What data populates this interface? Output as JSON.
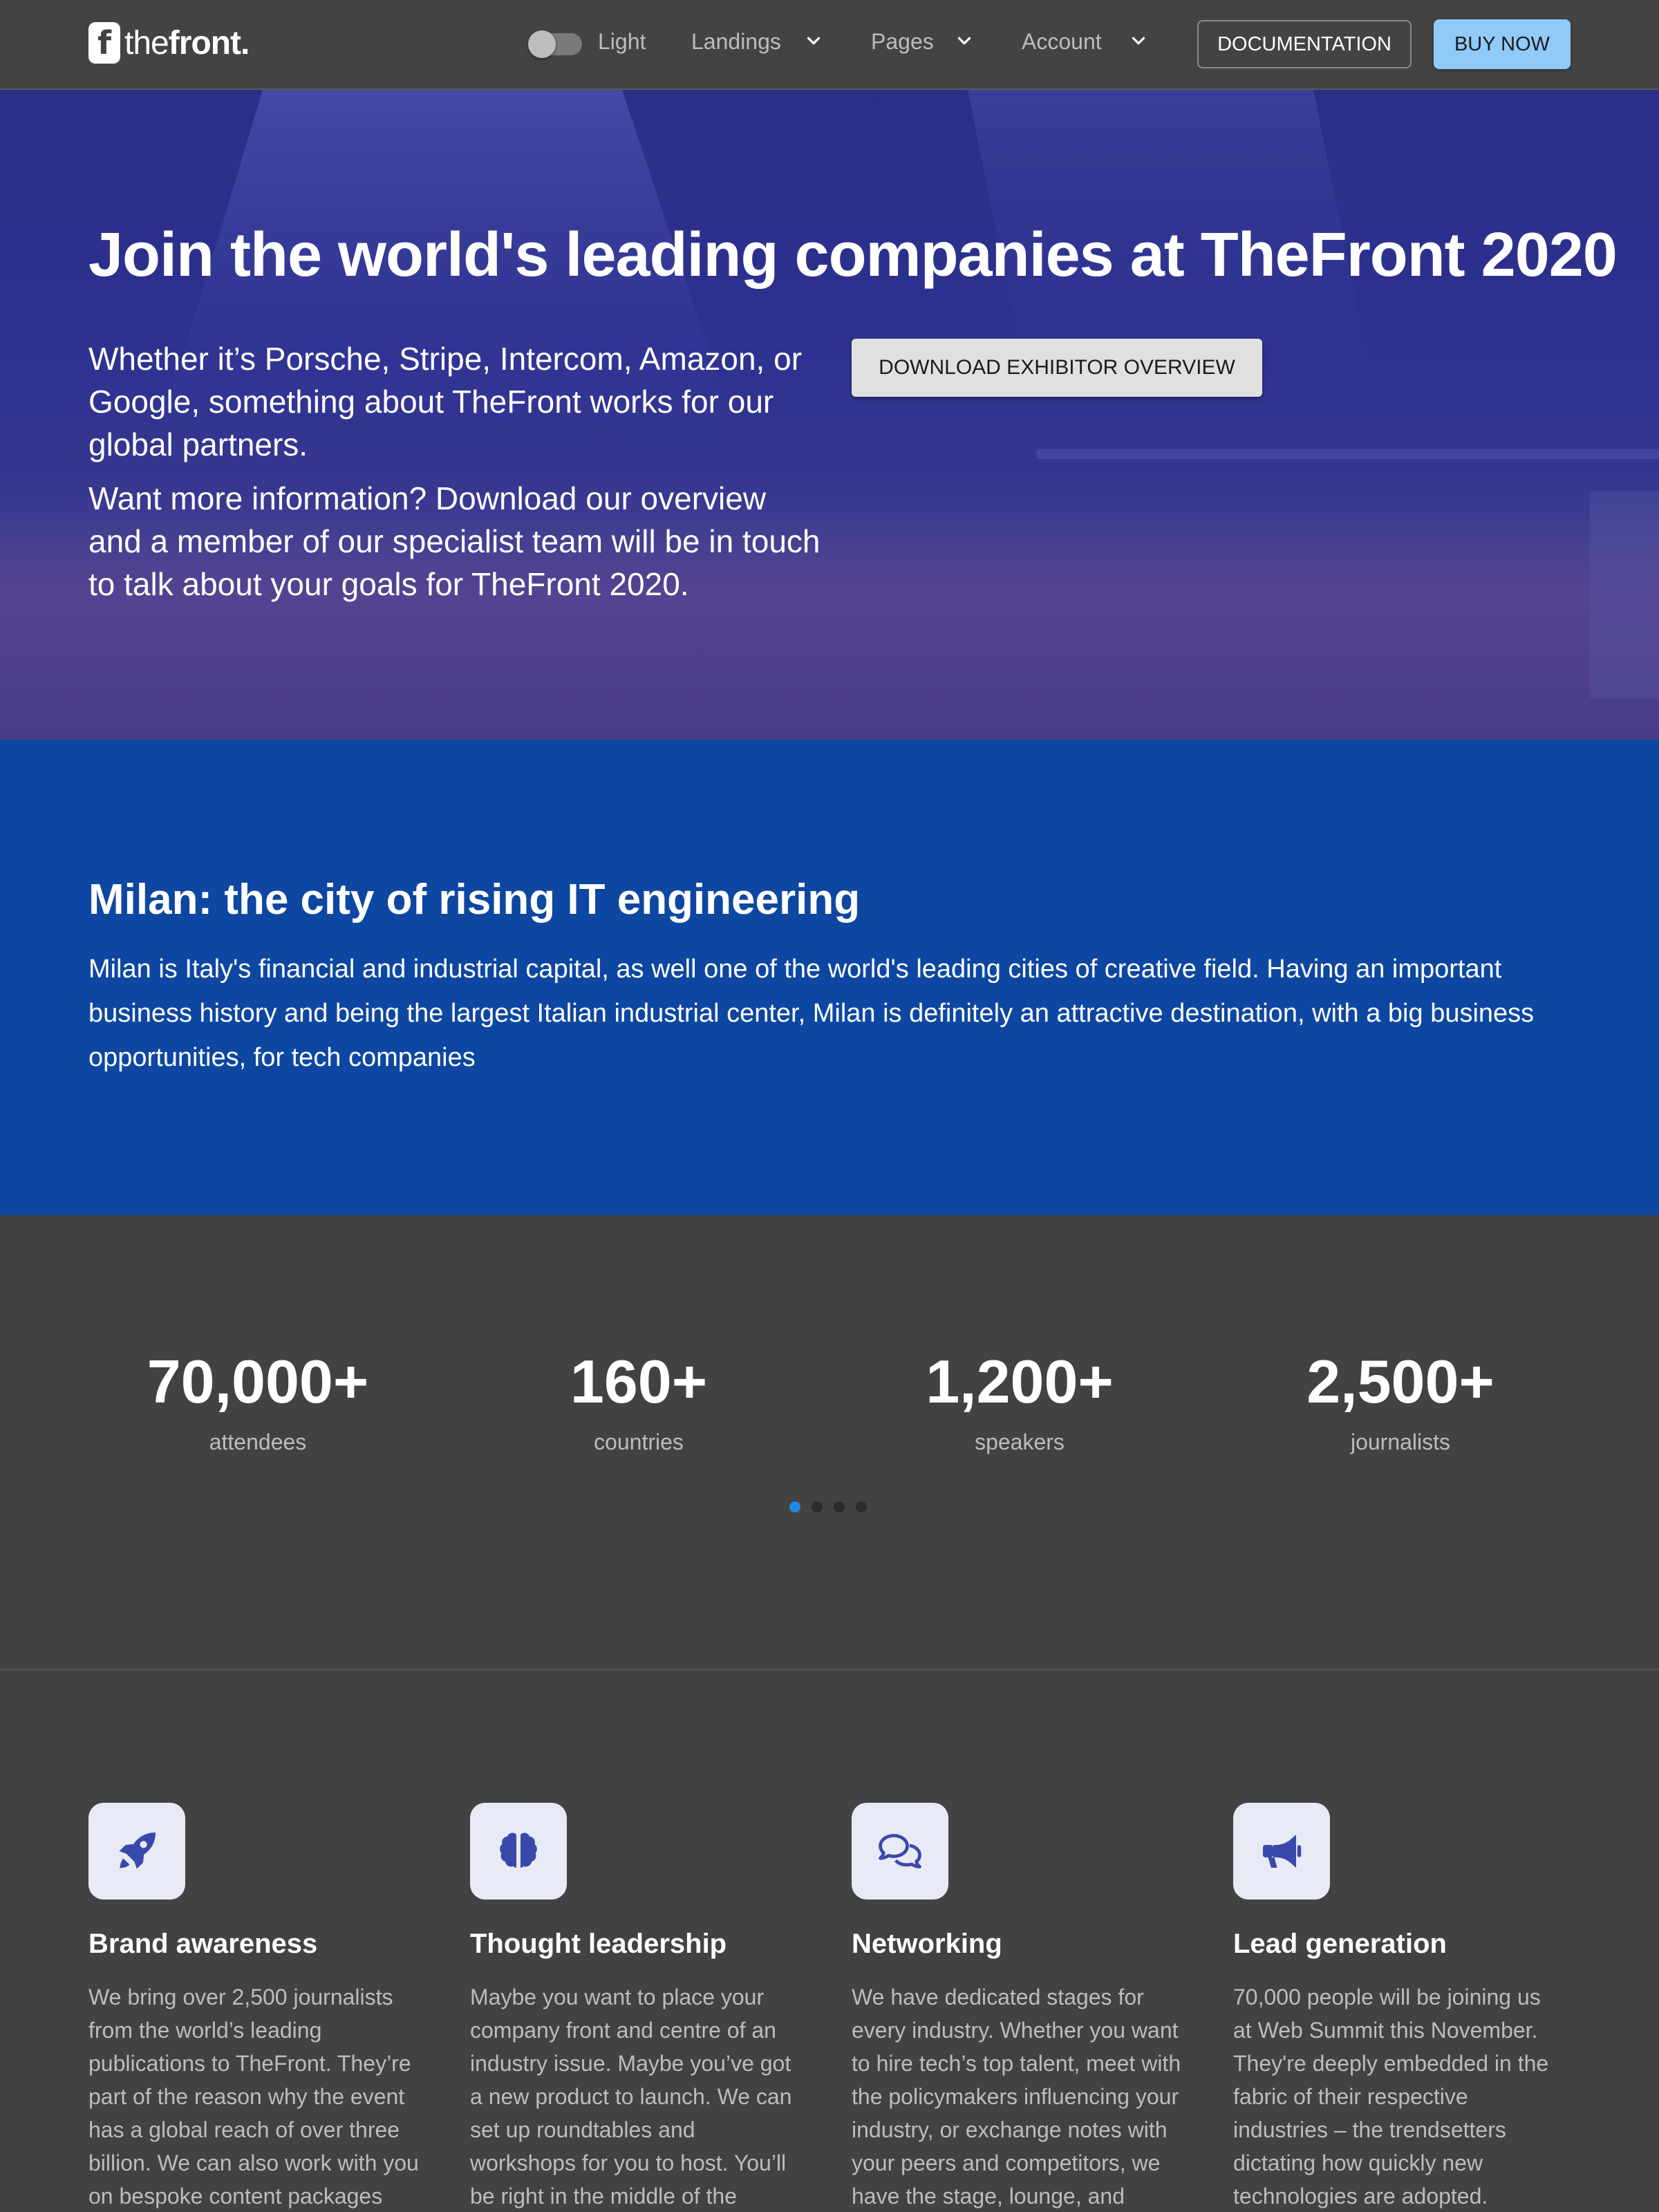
{
  "header": {
    "logo_letter": "f",
    "logo_text_light": "the",
    "logo_text_bold": "front.",
    "theme_toggle_label": "Light",
    "nav": [
      {
        "label": "Landings",
        "icon": "chevron-down-icon"
      },
      {
        "label": "Pages",
        "icon": "chevron-down-icon"
      },
      {
        "label": "Account",
        "icon": "chevron-down-icon"
      }
    ],
    "documentation_label": "DOCUMENTATION",
    "buy_label": "BUY NOW"
  },
  "hero": {
    "title": "Join the world's leading companies at TheFront 2020",
    "paragraph1": "Whether it’s Porsche, Stripe, Intercom, Amazon, or Google, something about TheFront works for our global partners.",
    "paragraph2": "Want more information? Download our overview and a member of our specialist team will be in touch to talk about your goals for TheFront 2020.",
    "download_label": "DOWNLOAD EXHIBITOR OVERVIEW"
  },
  "milan": {
    "title": "Milan: the city of rising IT engineering",
    "text": "Milan is Italy's financial and industrial capital, as well one of the world's leading cities of creative field. Having an important business history and being the largest Italian industrial center, Milan is definitely an attractive destination, with a big business opportunities, for tech companies"
  },
  "stats": [
    {
      "value": "70,000+",
      "label": "attendees"
    },
    {
      "value": "160+",
      "label": "countries"
    },
    {
      "value": "1,200+",
      "label": "speakers"
    },
    {
      "value": "2,500+",
      "label": "journalists"
    }
  ],
  "carousel": {
    "count": 4,
    "active_index": 0
  },
  "features": [
    {
      "icon": "rocket-icon",
      "title": "Brand awareness",
      "text": "We bring over 2,500 journalists from the world’s leading publications to TheFront. They’re part of the reason why the event has a global reach of over three billion. We can also work with you on bespoke content packages that"
    },
    {
      "icon": "brain-icon",
      "title": "Thought leadership",
      "text": "Maybe you want to place your company front and centre of an industry issue. Maybe you’ve got a new product to launch. We can set up roundtables and workshops for you to host. You’ll be right in the middle of the action, leading"
    },
    {
      "icon": "chat-bubbles-icon",
      "title": "Networking",
      "text": "We have dedicated stages for every industry. Whether you want to hire tech’s top talent, meet with the policymakers influencing your industry, or exchange notes with your peers and competitors, we have the stage, lounge, and"
    },
    {
      "icon": "megaphone-icon",
      "title": "Lead generation",
      "text": "70,000 people will be joining us at Web Summit this November. They're deeply embedded in the fabric of their respective industries – the trendsetters dictating how quickly new technologies are adopted."
    }
  ],
  "colors": {
    "header_bg": "#434343",
    "hero_overlay": "#2d3190",
    "milan_bg": "#0d47a1",
    "dark_bg": "#424242",
    "buy_button": "#90caf9",
    "accent": "#1e88e5",
    "icon_fg": "#3949ab",
    "icon_bg": "#e8eaf6"
  }
}
